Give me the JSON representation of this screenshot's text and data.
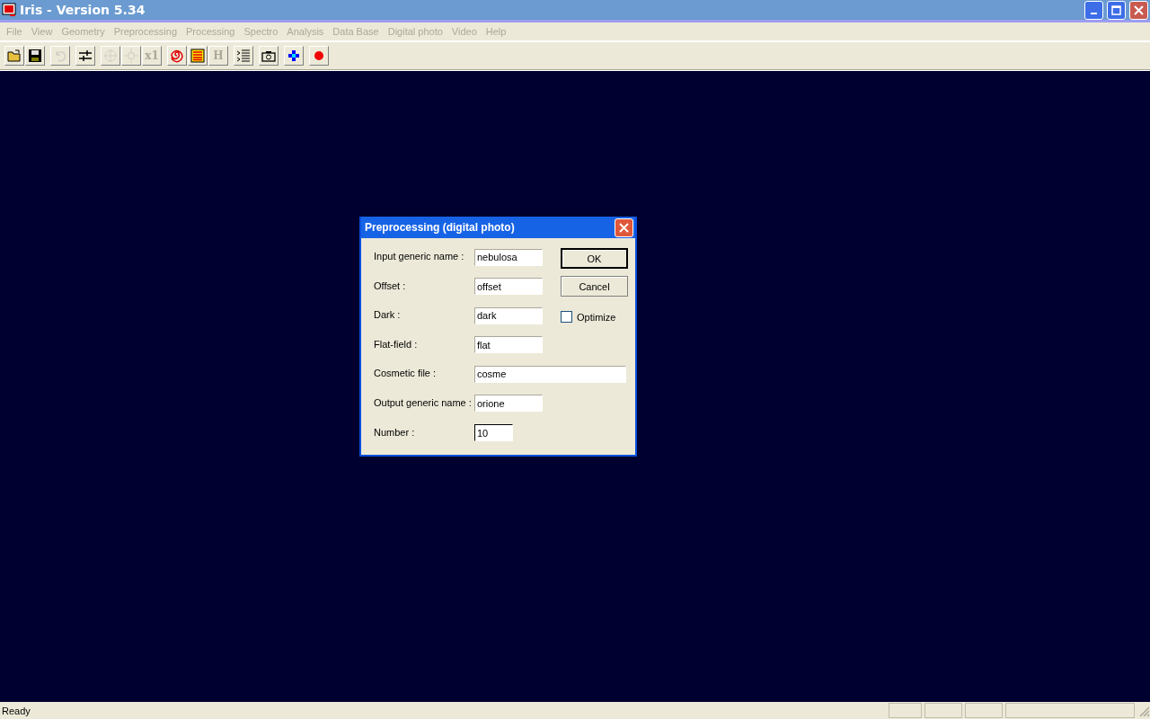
{
  "window": {
    "title": "Iris - Version 5.34"
  },
  "menu": [
    {
      "label": "File",
      "disabled": true
    },
    {
      "label": "View",
      "disabled": true
    },
    {
      "label": "Geometry",
      "disabled": true
    },
    {
      "label": "Preprocessing",
      "disabled": true
    },
    {
      "label": "Processing",
      "disabled": true
    },
    {
      "label": "Spectro",
      "disabled": true
    },
    {
      "label": "Analysis",
      "disabled": true
    },
    {
      "label": "Data Base",
      "disabled": true
    },
    {
      "label": "Digital photo",
      "disabled": true
    },
    {
      "label": "Video",
      "disabled": true
    },
    {
      "label": "Help",
      "disabled": true
    }
  ],
  "toolbar": [
    [
      {
        "kind": "open",
        "disabled": false
      },
      {
        "kind": "save",
        "disabled": false
      }
    ],
    [
      {
        "kind": "undo",
        "disabled": true
      }
    ],
    [
      {
        "kind": "sliders",
        "disabled": false
      }
    ],
    [
      {
        "kind": "target",
        "disabled": true
      },
      {
        "kind": "move",
        "disabled": true
      },
      {
        "kind": "text",
        "label": "x1",
        "disabled": true
      }
    ],
    [
      {
        "kind": "spiral",
        "disabled": false
      },
      {
        "kind": "palette",
        "disabled": false
      },
      {
        "kind": "text",
        "label": "H",
        "disabled": true
      }
    ],
    [
      {
        "kind": "list",
        "disabled": false
      }
    ],
    [
      {
        "kind": "camera",
        "disabled": false
      }
    ],
    [
      {
        "kind": "dots",
        "disabled": false
      }
    ],
    [
      {
        "kind": "dot",
        "disabled": false
      }
    ]
  ],
  "dialog": {
    "title": "Preprocessing (digital photo)",
    "fields": [
      {
        "label": "Input generic name :",
        "value": "nebulosa",
        "focused": false
      },
      {
        "label": "Offset :",
        "value": "offset",
        "focused": false
      },
      {
        "label": "Dark :",
        "value": "dark",
        "focused": false
      },
      {
        "label": "Flat-field :",
        "value": "flat",
        "focused": false
      },
      {
        "label": "Cosmetic file :",
        "value": "cosme",
        "focused": false
      },
      {
        "label": "Output generic name :",
        "value": "orione",
        "focused": false
      },
      {
        "label": "Number :",
        "value": "10",
        "focused": true
      }
    ],
    "buttons": [
      {
        "label": "OK",
        "default": true
      },
      {
        "label": "Cancel",
        "default": false
      }
    ],
    "optimize": {
      "label": "Optimize",
      "checked": false
    }
  },
  "status_bar": {
    "text": "Ready"
  }
}
